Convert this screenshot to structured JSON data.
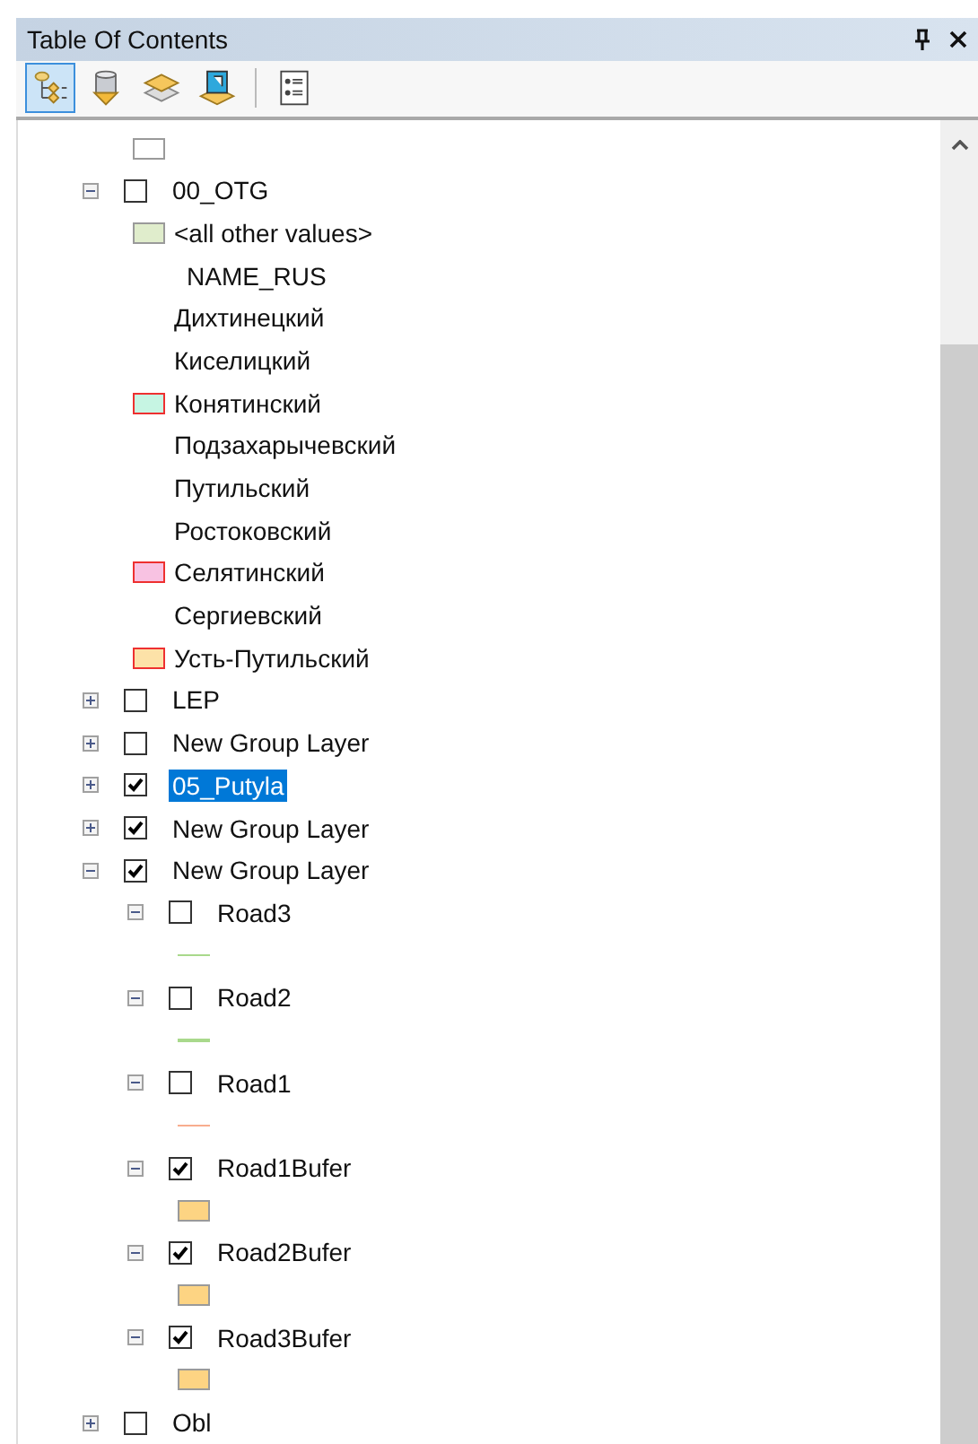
{
  "panel": {
    "title": "Table Of Contents"
  },
  "toolbar": [
    {
      "kind": "drawing-order",
      "selected": true
    },
    {
      "kind": "source",
      "selected": false
    },
    {
      "kind": "visibility",
      "selected": false
    },
    {
      "kind": "selection",
      "selected": false
    },
    {
      "kind": "separator"
    },
    {
      "kind": "options",
      "selected": false
    }
  ],
  "partial_legend": [
    {
      "kind": "swatch",
      "color": "#ffffff"
    }
  ],
  "layers": [
    {
      "name": "00_OTG",
      "checked": false,
      "expanded": true,
      "selected": false,
      "legend": [
        {
          "kind": "swatch",
          "label": "<all other values>",
          "color": "#e0edcc"
        },
        {
          "kind": "heading",
          "label": "NAME_RUS"
        },
        {
          "kind": "blank",
          "label": "Дихтинецкий"
        },
        {
          "kind": "blank",
          "label": "Киселицкий"
        },
        {
          "kind": "outlined",
          "label": "Конятинский",
          "color": "#c6f5e3"
        },
        {
          "kind": "blank",
          "label": "Подзахарычевский"
        },
        {
          "kind": "blank",
          "label": "Путильский"
        },
        {
          "kind": "blank",
          "label": "Ростоковский"
        },
        {
          "kind": "outlined",
          "label": "Селятинский",
          "color": "#f8c2e2"
        },
        {
          "kind": "blank",
          "label": "Сергиевский"
        },
        {
          "kind": "outlined",
          "label": "Усть-Путильский",
          "color": "#fde2a8"
        }
      ]
    },
    {
      "name": "LEP",
      "checked": false,
      "expanded": false,
      "selected": false
    },
    {
      "name": "New Group Layer",
      "checked": false,
      "expanded": false,
      "selected": false
    },
    {
      "name": "05_Putyla",
      "checked": true,
      "expanded": false,
      "selected": true
    },
    {
      "name": "New Group Layer",
      "checked": true,
      "expanded": false,
      "selected": false
    },
    {
      "name": "New Group Layer",
      "checked": true,
      "expanded": true,
      "selected": false,
      "children": [
        {
          "name": "Road3",
          "checked": false,
          "expanded": true,
          "selected": false,
          "legend": [
            {
              "kind": "line",
              "color": "#a9d98c"
            }
          ]
        },
        {
          "name": "Road2",
          "checked": false,
          "expanded": true,
          "selected": false,
          "legend": [
            {
              "kind": "line",
              "color": "#a9d98c"
            }
          ]
        },
        {
          "name": "Road1",
          "checked": false,
          "expanded": true,
          "selected": false,
          "legend": [
            {
              "kind": "line",
              "color": "#f8ad8e"
            }
          ]
        },
        {
          "name": "Road1Bufer",
          "checked": true,
          "expanded": true,
          "selected": false,
          "legend": [
            {
              "kind": "swatch",
              "color": "#fdd483"
            }
          ]
        },
        {
          "name": "Road2Bufer",
          "checked": true,
          "expanded": true,
          "selected": false,
          "legend": [
            {
              "kind": "swatch",
              "color": "#fdd483"
            }
          ]
        },
        {
          "name": "Road3Bufer",
          "checked": true,
          "expanded": true,
          "selected": false,
          "legend": [
            {
              "kind": "swatch",
              "color": "#fdd483"
            }
          ]
        }
      ]
    },
    {
      "name": "Obl",
      "checked": false,
      "expanded": false,
      "selected": false
    }
  ]
}
